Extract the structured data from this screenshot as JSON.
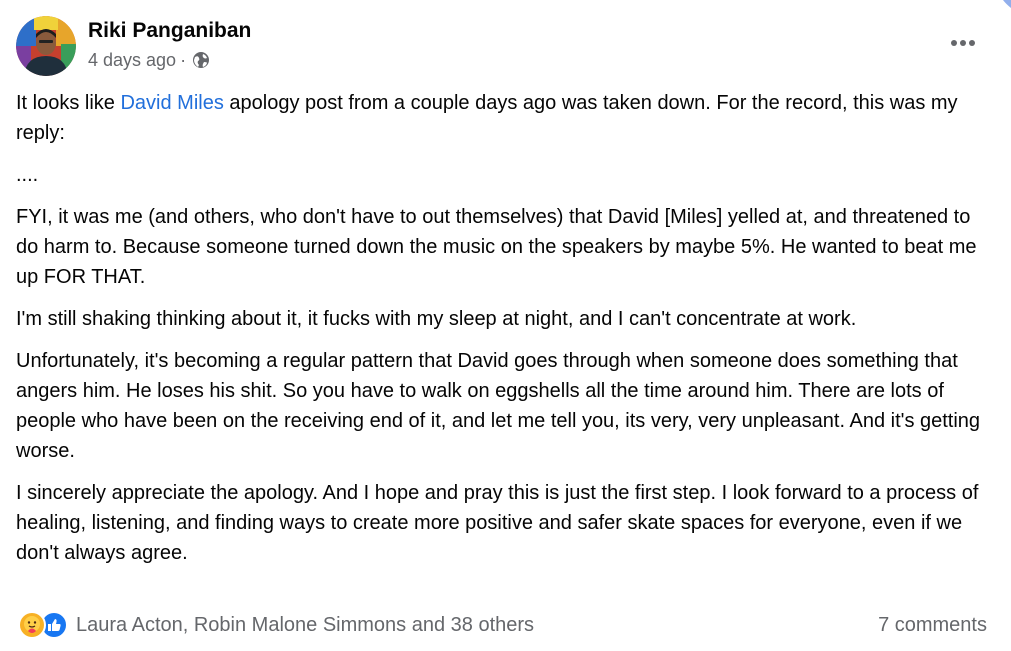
{
  "author": {
    "name": "Riki Panganiban",
    "timestamp": "4 days ago",
    "separator": "·",
    "audience_icon": "globe-icon"
  },
  "post": {
    "paragraph1": {
      "mention": "David Miles",
      "text_before": "It looks like ",
      "text_after": " apology post from a couple days ago was taken down. For the record, this was my reply:"
    },
    "paragraph2": "....",
    "paragraph3": "FYI, it was me (and others, who don't have to out themselves) that David [Miles] yelled at, and threatened to do harm to. Because someone turned down the music on the speakers by maybe 5%. He wanted to beat me up FOR THAT.",
    "paragraph4": "I'm still shaking thinking about it, it fucks with my sleep at night, and I can't concentrate at work.",
    "paragraph5": "Unfortunately, it's becoming a regular pattern that David goes through when someone does something that angers him. He loses his shit. So you have to walk on eggshells all the time around him. There are lots of people who have been on the receiving end of it, and let me tell you, its very, very unpleasant. And it's getting worse.",
    "paragraph6": "I sincerely appreciate the apology. And I hope and pray this is just the first step. I look forward to a process of healing, listening, and finding ways to create more positive and safer skate spaces for everyone, even if we don't always agree."
  },
  "footer": {
    "reaction_icons": [
      "care-icon",
      "like-icon"
    ],
    "reactions_text": "Laura Acton, Robin Malone Simmons and 38 others",
    "comments_text": "7 comments"
  },
  "colors": {
    "mention": "#216fdb",
    "secondary_text": "#65676b",
    "like_blue": "#1877f2",
    "care_yellow": "#f7b125"
  }
}
